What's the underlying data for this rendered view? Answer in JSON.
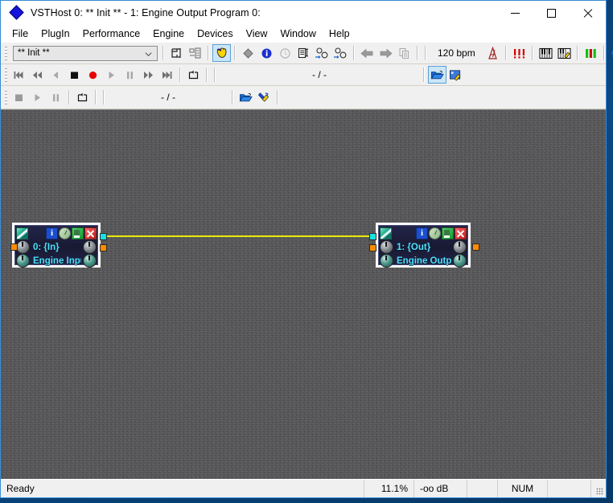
{
  "window": {
    "title": "VSTHost 0: ** Init ** - 1: Engine Output Program 0:",
    "icon": "blue-diamond-icon",
    "controls": {
      "minimize": "minimize-button",
      "maximize": "maximize-button",
      "close": "close-button"
    }
  },
  "menubar": {
    "items": [
      {
        "label": "File"
      },
      {
        "label": "PlugIn"
      },
      {
        "label": "Performance"
      },
      {
        "label": "Engine"
      },
      {
        "label": "Devices"
      },
      {
        "label": "View"
      },
      {
        "label": "Window"
      },
      {
        "label": "Help"
      }
    ]
  },
  "toolbar_main": {
    "preset_combo": {
      "value": "** Init **",
      "placeholder": "** Init **",
      "arrow_icon": "chevron-down-icon"
    },
    "buttons": [
      {
        "name": "chain-view-button",
        "icon": "chain-view-icon"
      },
      {
        "name": "rack-view-button",
        "icon": "rack-view-icon"
      },
      {
        "name": "performance-view-button",
        "icon": "performance-hand-icon",
        "active": true
      },
      {
        "name": "plugin-diamond-button",
        "icon": "diamond-icon"
      },
      {
        "name": "plugin-info-button",
        "icon": "info-icon"
      },
      {
        "name": "plugin-clock-button",
        "icon": "clock-icon"
      },
      {
        "name": "plugin-list-button",
        "icon": "list-plus-icon"
      },
      {
        "name": "midi-routing-in-button",
        "icon": "midi-in-icon"
      },
      {
        "name": "midi-routing-out-button",
        "icon": "midi-out-icon"
      },
      {
        "name": "prev-button",
        "icon": "arrow-left-icon"
      },
      {
        "name": "next-button",
        "icon": "arrow-right-icon"
      },
      {
        "name": "copy-button",
        "icon": "copy-icon"
      }
    ],
    "tempo": "120 bpm",
    "right_buttons": [
      {
        "name": "metronome-button",
        "icon": "metronome-icon"
      },
      {
        "name": "panic-button",
        "icon": "panic-icon"
      },
      {
        "name": "keyboard-button",
        "icon": "piano-keyboard-icon"
      },
      {
        "name": "midi-setup-button",
        "icon": "keyboard-wrench-icon"
      },
      {
        "name": "level-meter-button",
        "icon": "level-meter-icon"
      },
      {
        "name": "open-button",
        "icon": "folder-open-icon"
      },
      {
        "name": "save-button",
        "icon": "floppy-save-icon"
      }
    ]
  },
  "toolbar_transport_1": {
    "buttons": [
      {
        "name": "skip-start-button",
        "icon": "skip-start-icon"
      },
      {
        "name": "rewind-button",
        "icon": "rewind-icon"
      },
      {
        "name": "step-back-button",
        "icon": "step-back-icon"
      },
      {
        "name": "stop-button",
        "icon": "stop-icon"
      },
      {
        "name": "record-button",
        "icon": "record-icon"
      },
      {
        "name": "play-button",
        "icon": "play-icon"
      },
      {
        "name": "pause-button",
        "icon": "pause-icon"
      },
      {
        "name": "fast-forward-button",
        "icon": "fast-forward-icon"
      },
      {
        "name": "skip-end-button",
        "icon": "skip-end-icon"
      },
      {
        "name": "loop-button",
        "icon": "loop-icon"
      }
    ],
    "position": "- / -",
    "right_buttons": [
      {
        "name": "load-chain-button",
        "icon": "folder-open-icon",
        "active": true
      },
      {
        "name": "chain-settings-button",
        "icon": "folder-wrench-icon"
      }
    ]
  },
  "toolbar_transport_2": {
    "buttons": [
      {
        "name": "wave-stop-button",
        "icon": "stop-icon"
      },
      {
        "name": "wave-play-button",
        "icon": "play-icon"
      },
      {
        "name": "wave-pause-button",
        "icon": "pause-icon"
      },
      {
        "name": "wave-loop-button",
        "icon": "loop-icon"
      }
    ],
    "position": "- / -",
    "right_buttons": [
      {
        "name": "wave-open-button",
        "icon": "folder-open-icon"
      },
      {
        "name": "wave-settings-button",
        "icon": "wrench-icon"
      }
    ]
  },
  "canvas": {
    "background_color": "#59595b",
    "wire_color": "#e8e800",
    "port_colors": {
      "audio": "#ff8c00",
      "midi": "#19e0e0"
    },
    "plugins": [
      {
        "name": "engine-input",
        "index_label": "0: {In}",
        "title": "Engine Input",
        "header_icons": [
          "cable-icon",
          "info-icon",
          "clock-icon",
          "list-icon",
          "close-icon"
        ]
      },
      {
        "name": "engine-output",
        "index_label": "1: {Out}",
        "title": "Engine Output",
        "header_icons": [
          "cable-icon",
          "info-icon",
          "clock-icon",
          "list-icon",
          "close-icon"
        ]
      }
    ]
  },
  "statusbar": {
    "message": "Ready",
    "cpu": "11.1%",
    "level": "-oo dB",
    "num_lock": "NUM"
  }
}
